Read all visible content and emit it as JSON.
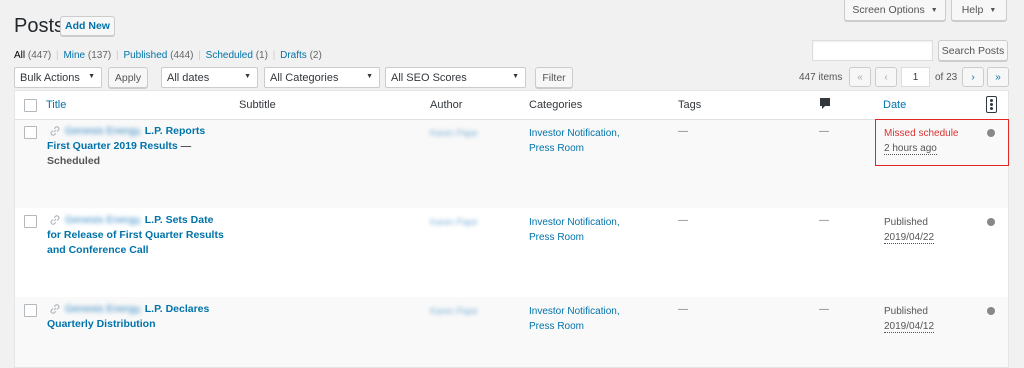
{
  "header": {
    "title": "Posts",
    "add_new": "Add New",
    "screen_options": "Screen Options",
    "help": "Help"
  },
  "filters": {
    "all": "All",
    "all_count": "(447)",
    "mine": "Mine",
    "mine_count": "(137)",
    "published": "Published",
    "published_count": "(444)",
    "scheduled": "Scheduled",
    "scheduled_count": "(1)",
    "drafts": "Drafts",
    "drafts_count": "(2)",
    "sep": "|"
  },
  "search": {
    "placeholder": "",
    "button": "Search Posts"
  },
  "toolbar": {
    "bulk_actions": "Bulk Actions",
    "apply": "Apply",
    "dates": "All dates",
    "categories": "All Categories",
    "seo": "All SEO Scores",
    "filter": "Filter"
  },
  "pagination": {
    "items": "447 items",
    "first": "«",
    "prev": "‹",
    "current": "1",
    "of": "of 23",
    "next": "›",
    "last": "»"
  },
  "columns": {
    "title": "Title",
    "subtitle": "Subtitle",
    "author": "Author",
    "categories": "Categories",
    "tags": "Tags",
    "date": "Date"
  },
  "rows": [
    {
      "title_blur": "Genesis Energy,",
      "title_rest": " L.P. Reports First Quarter 2019 Results",
      "state": " — Scheduled",
      "author": "Karen Pape",
      "categories": "Investor Notification, Press Room",
      "tags": "—",
      "comments": "—",
      "date_status": "Missed schedule",
      "date_value": "2 hours ago"
    },
    {
      "title_blur": "Genesis Energy,",
      "title_rest": " L.P. Sets Date for Release of First Quarter Results and Conference Call",
      "state": "",
      "author": "Karen Pape",
      "categories": "Investor Notification, Press Room",
      "tags": "—",
      "comments": "—",
      "date_status": "Published",
      "date_value": "2019/04/22"
    },
    {
      "title_blur": "Genesis Energy,",
      "title_rest": " L.P. Declares Quarterly Distribution",
      "state": "",
      "author": "Karen Pape",
      "categories": "Investor Notification, Press Room",
      "tags": "—",
      "comments": "—",
      "date_status": "Published",
      "date_value": "2019/04/12"
    }
  ],
  "colors": {
    "link": "#0073aa",
    "missed": "#dc3232",
    "highlight": "#e32525"
  }
}
